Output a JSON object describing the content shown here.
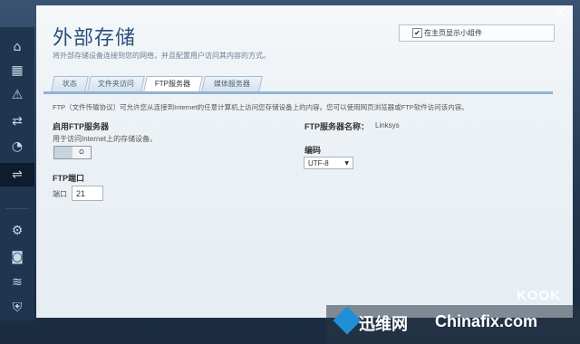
{
  "window": {
    "close_label": "✕"
  },
  "header": {
    "title": "外部存储",
    "subtitle": "将外部存储设备连接到您的网络，并且配置用户访问其内容的方式。",
    "show_widget_checked_glyph": "✔",
    "show_widget_label": "在主页显示小组件"
  },
  "sidebar": {
    "icons": [
      "router-icon",
      "calendar-icon",
      "warning-icon",
      "devices-icon",
      "speed-icon",
      "usb-icon",
      "gear-icon",
      "camera-icon",
      "wifi-icon",
      "shield-icon"
    ],
    "glyphs": [
      "⌂",
      "▦",
      "⚠",
      "⇄",
      "◔",
      "⇌",
      "⚙",
      "◙",
      "≋",
      "⛨"
    ]
  },
  "tabs": [
    {
      "label": "状态"
    },
    {
      "label": "文件夹访问"
    },
    {
      "label": "FTP服务器"
    },
    {
      "label": "媒体服务器"
    }
  ],
  "main": {
    "description": "FTP（文件传输协议）可允许您从连接到Internet的任意计算机上访问您存储设备上的内容。您可以使用网页浏览器或FTP软件访问该内容。",
    "enable_ftp_heading": "启用FTP服务器",
    "enable_ftp_help": "用于访问Internet上的存储设备。",
    "toggle_state": "O",
    "ftp_port_heading": "FTP端口",
    "port_label": "端口",
    "port_value": "21",
    "server_name_label": "FTP服务器名称：",
    "server_name_value": "Linksys",
    "encoding_heading": "编码",
    "encoding_value": "UTF-8",
    "encoding_arrow": "▼"
  },
  "watermark": {
    "brand_cn": "迅维网",
    "brand_en": "Chinafix.com",
    "corner": "KOOK"
  }
}
